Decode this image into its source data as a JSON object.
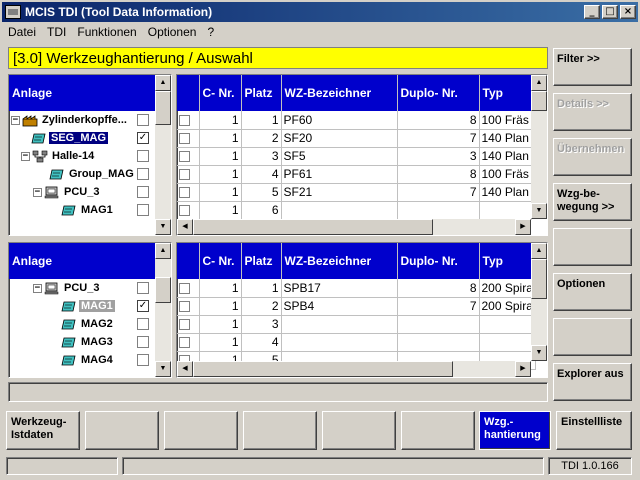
{
  "window": {
    "title": "MCIS TDI (Tool Data Information)"
  },
  "window_buttons": {
    "minimize": "_",
    "maximize": "□",
    "close": "×"
  },
  "menu": [
    "Datei",
    "TDI",
    "Funktionen",
    "Optionen",
    "?"
  ],
  "header": "[3.0] Werkzeughantierung / Auswahl",
  "top_tree": {
    "heading": "Anlage",
    "items": [
      {
        "label": "Zylinderkopffe...",
        "checked": ""
      },
      {
        "label": "SEG_MAG",
        "checked": "✓"
      },
      {
        "label": "Halle-14",
        "checked": ""
      },
      {
        "label": "Group_MAG",
        "checked": ""
      },
      {
        "label": "PCU_3",
        "checked": ""
      },
      {
        "label": "MAG1",
        "checked": ""
      }
    ]
  },
  "bottom_tree": {
    "heading": "Anlage",
    "items": [
      {
        "label": "PCU_3",
        "checked": ""
      },
      {
        "label": "MAG1",
        "checked": "✓"
      },
      {
        "label": "MAG2",
        "checked": ""
      },
      {
        "label": "MAG3",
        "checked": ""
      },
      {
        "label": "MAG4",
        "checked": ""
      }
    ]
  },
  "columns": [
    "C- Nr.",
    "Platz",
    "WZ-Bezeichner",
    "Duplo- Nr.",
    "Typ"
  ],
  "top_grid": [
    [
      "1",
      "1",
      "PF60",
      "8",
      "100 Fräs"
    ],
    [
      "1",
      "2",
      "SF20",
      "7",
      "140 Plan"
    ],
    [
      "1",
      "3",
      "SF5",
      "3",
      "140 Plan"
    ],
    [
      "1",
      "4",
      "PF61",
      "8",
      "100 Fräs"
    ],
    [
      "1",
      "5",
      "SF21",
      "7",
      "140 Plan"
    ],
    [
      "1",
      "6",
      "",
      "",
      ""
    ]
  ],
  "bottom_grid": [
    [
      "1",
      "1",
      "SPB17",
      "8",
      "200 Spira"
    ],
    [
      "1",
      "2",
      "SPB4",
      "7",
      "200 Spira"
    ],
    [
      "1",
      "3",
      "",
      "",
      ""
    ],
    [
      "1",
      "4",
      "",
      "",
      ""
    ],
    [
      "1",
      "5",
      "",
      "",
      ""
    ]
  ],
  "softkeys_right": [
    {
      "label": "Filter >>",
      "enabled": true
    },
    {
      "label": "Details >>",
      "enabled": false
    },
    {
      "label": "Übernehmen",
      "enabled": false
    },
    {
      "label": "Wzg-be-\nwegung >>",
      "enabled": true
    },
    {
      "label": "",
      "enabled": true
    },
    {
      "label": "Optionen",
      "enabled": true
    },
    {
      "label": "",
      "enabled": true
    },
    {
      "label": "Explorer aus",
      "enabled": true
    }
  ],
  "softkeys_bottom": [
    {
      "label": "Werkzeug-\nIstdaten",
      "active": false
    },
    {
      "label": "",
      "active": false
    },
    {
      "label": "",
      "active": false
    },
    {
      "label": "",
      "active": false
    },
    {
      "label": "",
      "active": false
    },
    {
      "label": "",
      "active": false
    },
    {
      "label": "Wzg.-\nhantierung",
      "active": true
    },
    {
      "label": "Einstellliste",
      "active": false
    }
  ],
  "status": {
    "left": "",
    "middle": "",
    "version": "TDI 1.0.166"
  },
  "colors": {
    "header_blue": "#0000cc",
    "highlight_yellow": "#ffff00",
    "selection": "#000080"
  }
}
